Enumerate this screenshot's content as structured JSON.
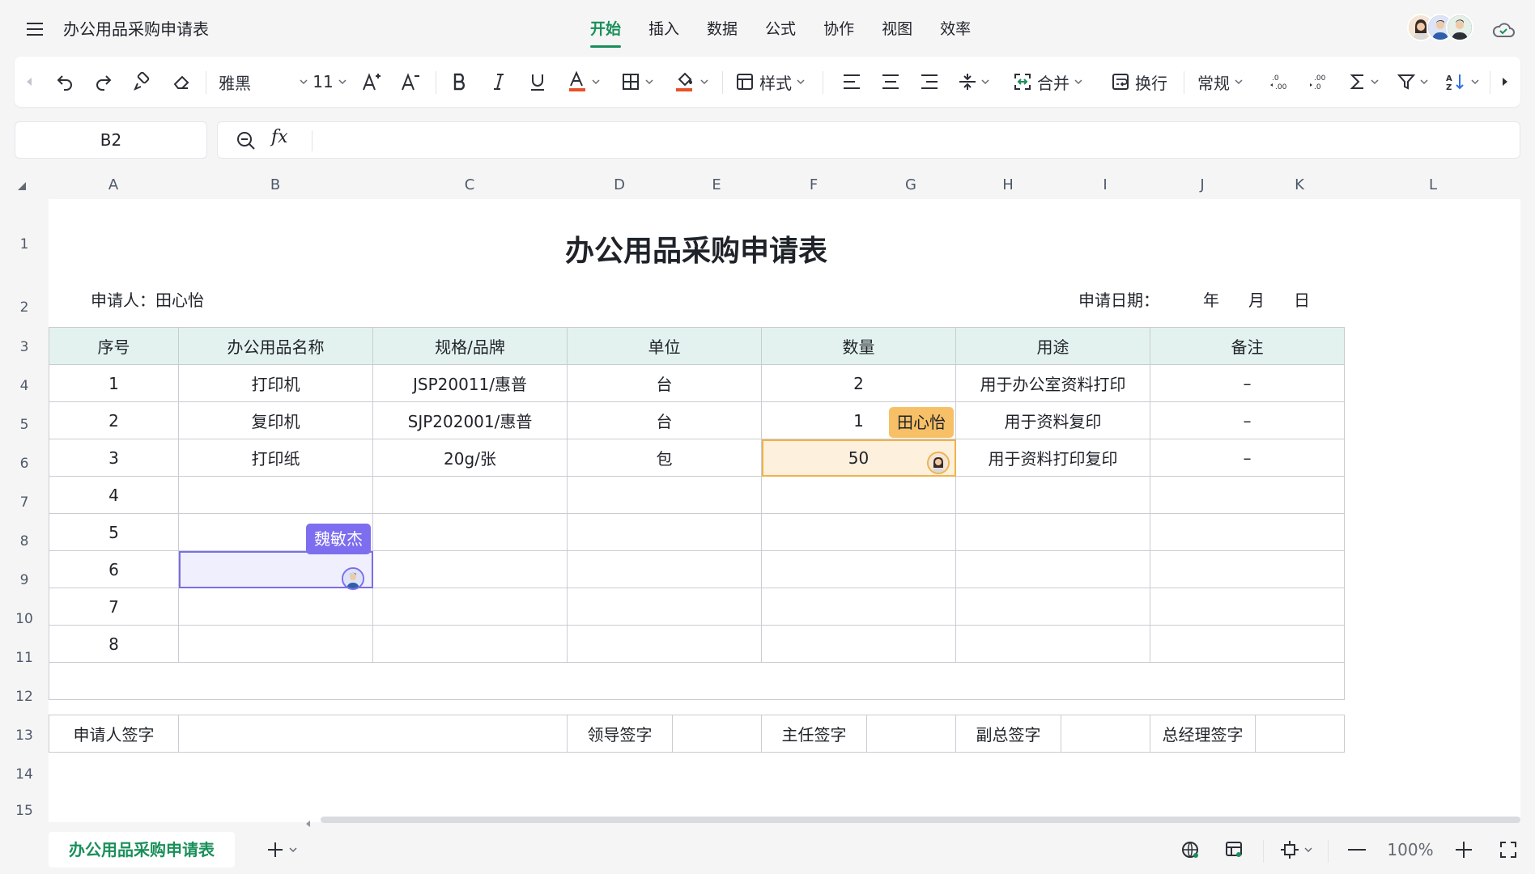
{
  "header": {
    "doc_title": "办公用品采购申请表",
    "tabs": [
      {
        "label": "开始",
        "active": true
      },
      {
        "label": "插入"
      },
      {
        "label": "数据"
      },
      {
        "label": "公式"
      },
      {
        "label": "协作"
      },
      {
        "label": "视图"
      },
      {
        "label": "效率"
      }
    ]
  },
  "toolbar": {
    "font_name": "雅黑",
    "font_size": "11",
    "style_label": "样式",
    "merge_label": "合并",
    "wrap_label": "换行",
    "number_format": "常规",
    "accent_color": "#1a8f5a",
    "font_color_bar": "#e8512a",
    "fill_color_bar": "#e8512a"
  },
  "formula_bar": {
    "cell_ref": "B2",
    "fx_label": "fx",
    "value": ""
  },
  "columns": [
    "A",
    "B",
    "C",
    "D",
    "E",
    "F",
    "G",
    "H",
    "I",
    "J",
    "K",
    "L"
  ],
  "rows": [
    "1",
    "2",
    "3",
    "4",
    "5",
    "6",
    "7",
    "8",
    "9",
    "10",
    "11",
    "12",
    "13",
    "14",
    "15"
  ],
  "sheet": {
    "title": "办公用品采购申请表",
    "applicant_label": "申请人：田心怡",
    "date_label": "申请日期：",
    "year": "年",
    "month": "月",
    "day": "日",
    "table_headers": [
      "序号",
      "办公用品名称",
      "规格/品牌",
      "单位",
      "数量",
      "用途",
      "备注"
    ],
    "table_rows": [
      [
        "1",
        "打印机",
        "JSP20011/惠普",
        "台",
        "2",
        "用于办公室资料打印",
        "–"
      ],
      [
        "2",
        "复印机",
        "SJP202001/惠普",
        "台",
        "1",
        "用于资料复印",
        "–"
      ],
      [
        "3",
        "打印纸",
        "20g/张",
        "包",
        "50",
        "用于资料打印复印",
        "–"
      ],
      [
        "4",
        "",
        "",
        "",
        "",
        "",
        ""
      ],
      [
        "5",
        "",
        "",
        "",
        "",
        "",
        ""
      ],
      [
        "6",
        "",
        "",
        "",
        "",
        "",
        ""
      ],
      [
        "7",
        "",
        "",
        "",
        "",
        "",
        ""
      ],
      [
        "8",
        "",
        "",
        "",
        "",
        "",
        ""
      ]
    ],
    "signatures": [
      "申请人签字",
      "领导签字",
      "主任签字",
      "副总签字",
      "总经理签字"
    ],
    "collaborator_tags": {
      "orange": "田心怡",
      "purple": "魏敏杰"
    }
  },
  "bottom": {
    "sheet_tab": "办公用品采购申请表",
    "zoom": "100%"
  }
}
